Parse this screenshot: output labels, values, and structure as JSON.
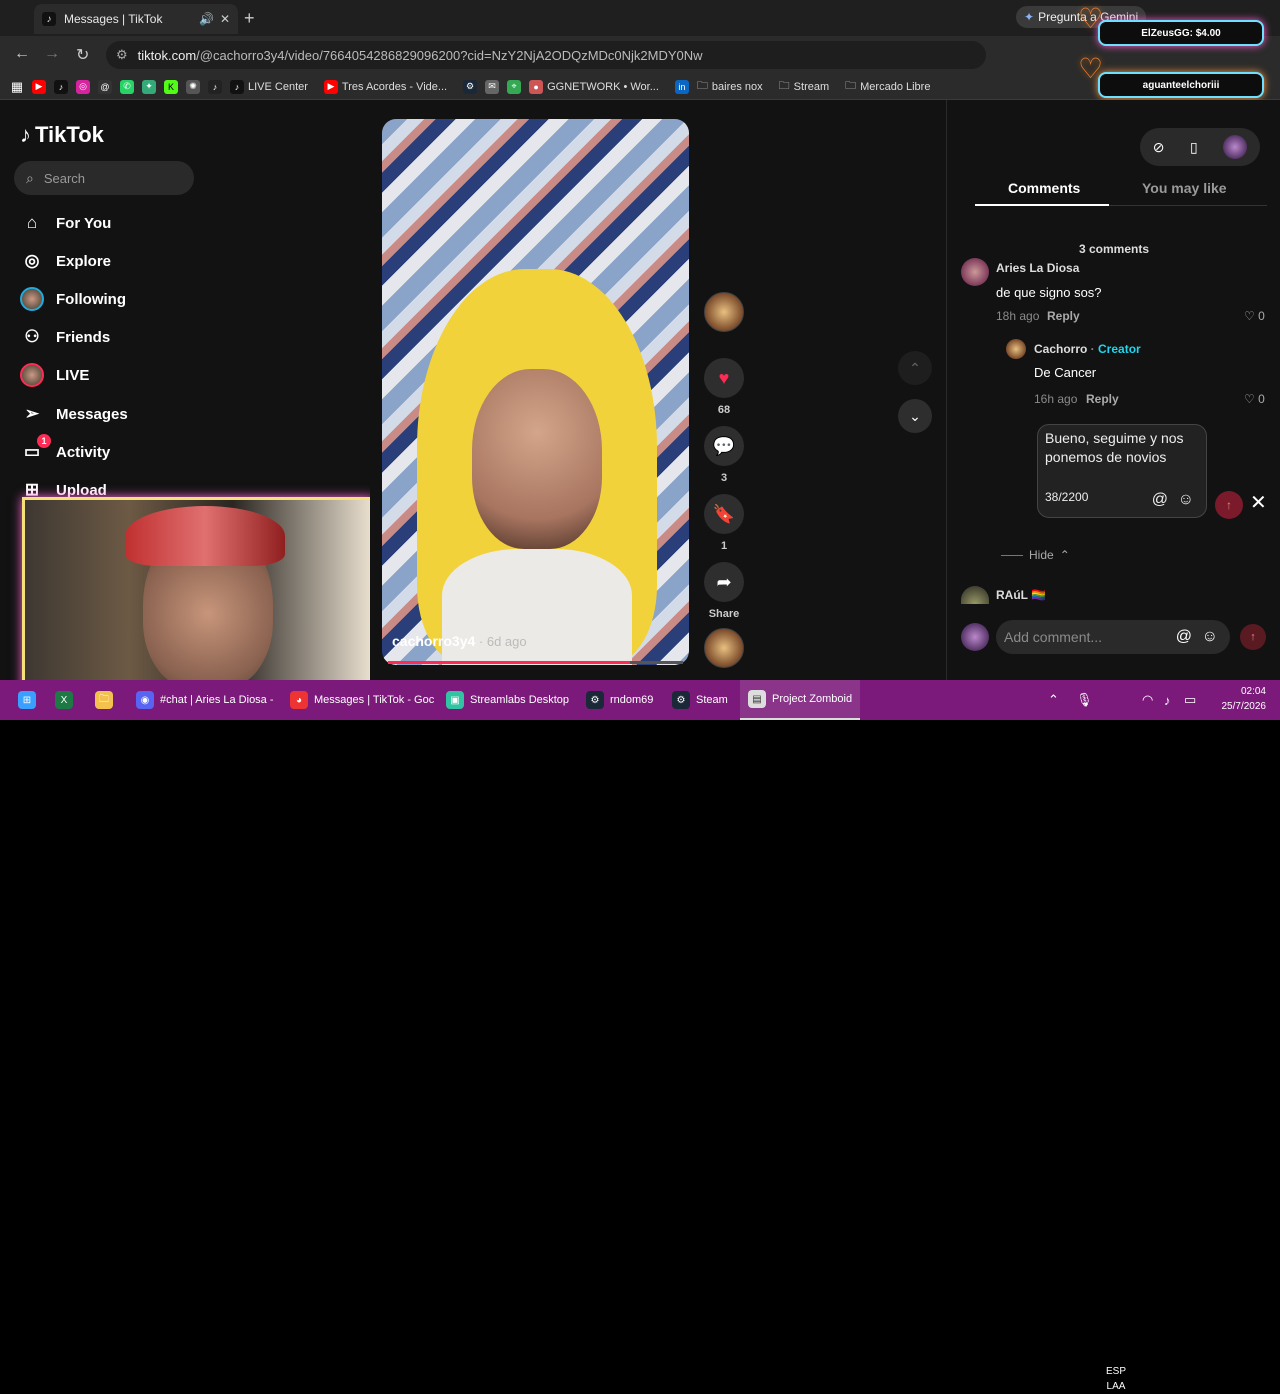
{
  "browser": {
    "tab_title": "Messages | TikTok",
    "url_host": "tiktok.com",
    "url_path": "/@cachorro3y4/video/7664054286829096200?cid=NzY2NjA2ODQzMDc0Njk2MDY0Nw",
    "gemini": "Pregunta a Gemini",
    "bookmarks": [
      "LIVE Center",
      "Tres Acordes - Vide...",
      "GGNETWORK • Wor...",
      "baires nox",
      "Stream",
      "Mercado Libre"
    ]
  },
  "overlay": {
    "donation": "ElZeusGG: $4.00",
    "follower": "aguanteelchoriii"
  },
  "sidebar": {
    "logo": "TikTok",
    "search_placeholder": "Search",
    "items": [
      {
        "label": "For You",
        "icon": "home-icon"
      },
      {
        "label": "Explore",
        "icon": "compass-icon"
      },
      {
        "label": "Following",
        "icon": "avatar-icon"
      },
      {
        "label": "Friends",
        "icon": "friends-icon"
      },
      {
        "label": "LIVE",
        "icon": "live-avatar-icon"
      },
      {
        "label": "Messages",
        "icon": "send-icon"
      },
      {
        "label": "Activity",
        "icon": "inbox-icon",
        "badge": "1"
      },
      {
        "label": "Upload",
        "icon": "plus-square-icon"
      }
    ]
  },
  "video": {
    "username": "cachorro3y4",
    "ago": "6d ago",
    "progress": 0.82
  },
  "actions": {
    "likes": "68",
    "comments": "3",
    "saves": "1",
    "share": "Share"
  },
  "panel": {
    "tab_comments": "Comments",
    "tab_like": "You may like",
    "comment_count": "3 comments",
    "comments": [
      {
        "name": "Aries La Diosa",
        "text": "de que signo sos?",
        "time": "18h ago",
        "reply": "Reply",
        "likes": "0"
      },
      {
        "name": "Cachorro",
        "tag": "Creator",
        "text": "De Cancer",
        "time": "16h ago",
        "reply": "Reply",
        "likes": "0"
      },
      {
        "name": "RAúL 🏳️‍🌈"
      }
    ],
    "reply_text": "Bueno, seguime y nos ponemos de novios",
    "reply_count": "38/2200",
    "hide": "Hide",
    "add_placeholder": "Add comment..."
  },
  "taskbar": {
    "items": [
      "#chat | Aries La Diosa -",
      "Messages | TikTok - Goc",
      "Streamlabs Desktop",
      "rndom69",
      "Steam",
      "Project Zomboid"
    ],
    "lang": "ESP",
    "lang2": "LAA",
    "time": "02:04",
    "date": "25/7/2026"
  },
  "colors": {
    "accent": "#fe2c55",
    "creator": "#20d5ec",
    "taskbar": "#7b1a7a"
  }
}
